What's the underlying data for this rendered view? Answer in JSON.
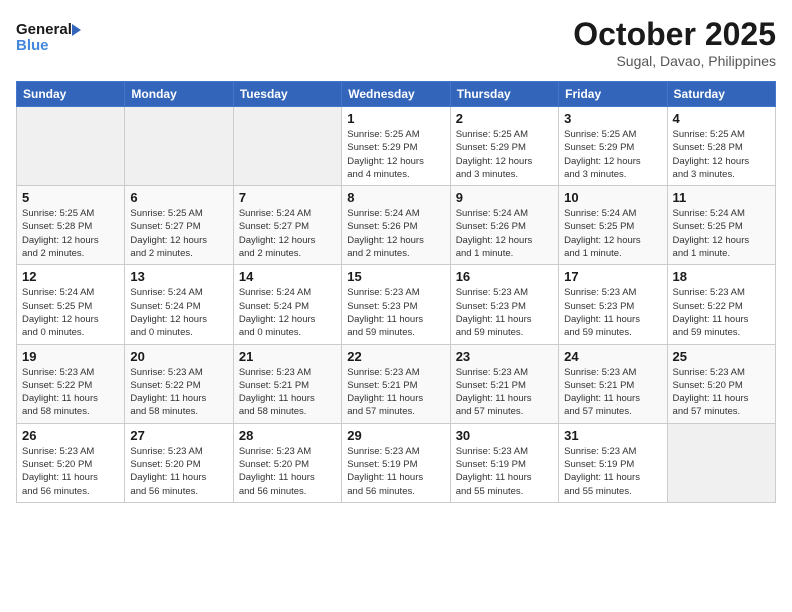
{
  "logo": {
    "line1": "General",
    "line2": "Blue"
  },
  "title": "October 2025",
  "location": "Sugal, Davao, Philippines",
  "weekdays": [
    "Sunday",
    "Monday",
    "Tuesday",
    "Wednesday",
    "Thursday",
    "Friday",
    "Saturday"
  ],
  "weeks": [
    [
      {
        "day": "",
        "info": ""
      },
      {
        "day": "",
        "info": ""
      },
      {
        "day": "",
        "info": ""
      },
      {
        "day": "1",
        "info": "Sunrise: 5:25 AM\nSunset: 5:29 PM\nDaylight: 12 hours\nand 4 minutes."
      },
      {
        "day": "2",
        "info": "Sunrise: 5:25 AM\nSunset: 5:29 PM\nDaylight: 12 hours\nand 3 minutes."
      },
      {
        "day": "3",
        "info": "Sunrise: 5:25 AM\nSunset: 5:29 PM\nDaylight: 12 hours\nand 3 minutes."
      },
      {
        "day": "4",
        "info": "Sunrise: 5:25 AM\nSunset: 5:28 PM\nDaylight: 12 hours\nand 3 minutes."
      }
    ],
    [
      {
        "day": "5",
        "info": "Sunrise: 5:25 AM\nSunset: 5:28 PM\nDaylight: 12 hours\nand 2 minutes."
      },
      {
        "day": "6",
        "info": "Sunrise: 5:25 AM\nSunset: 5:27 PM\nDaylight: 12 hours\nand 2 minutes."
      },
      {
        "day": "7",
        "info": "Sunrise: 5:24 AM\nSunset: 5:27 PM\nDaylight: 12 hours\nand 2 minutes."
      },
      {
        "day": "8",
        "info": "Sunrise: 5:24 AM\nSunset: 5:26 PM\nDaylight: 12 hours\nand 2 minutes."
      },
      {
        "day": "9",
        "info": "Sunrise: 5:24 AM\nSunset: 5:26 PM\nDaylight: 12 hours\nand 1 minute."
      },
      {
        "day": "10",
        "info": "Sunrise: 5:24 AM\nSunset: 5:25 PM\nDaylight: 12 hours\nand 1 minute."
      },
      {
        "day": "11",
        "info": "Sunrise: 5:24 AM\nSunset: 5:25 PM\nDaylight: 12 hours\nand 1 minute."
      }
    ],
    [
      {
        "day": "12",
        "info": "Sunrise: 5:24 AM\nSunset: 5:25 PM\nDaylight: 12 hours\nand 0 minutes."
      },
      {
        "day": "13",
        "info": "Sunrise: 5:24 AM\nSunset: 5:24 PM\nDaylight: 12 hours\nand 0 minutes."
      },
      {
        "day": "14",
        "info": "Sunrise: 5:24 AM\nSunset: 5:24 PM\nDaylight: 12 hours\nand 0 minutes."
      },
      {
        "day": "15",
        "info": "Sunrise: 5:23 AM\nSunset: 5:23 PM\nDaylight: 11 hours\nand 59 minutes."
      },
      {
        "day": "16",
        "info": "Sunrise: 5:23 AM\nSunset: 5:23 PM\nDaylight: 11 hours\nand 59 minutes."
      },
      {
        "day": "17",
        "info": "Sunrise: 5:23 AM\nSunset: 5:23 PM\nDaylight: 11 hours\nand 59 minutes."
      },
      {
        "day": "18",
        "info": "Sunrise: 5:23 AM\nSunset: 5:22 PM\nDaylight: 11 hours\nand 59 minutes."
      }
    ],
    [
      {
        "day": "19",
        "info": "Sunrise: 5:23 AM\nSunset: 5:22 PM\nDaylight: 11 hours\nand 58 minutes."
      },
      {
        "day": "20",
        "info": "Sunrise: 5:23 AM\nSunset: 5:22 PM\nDaylight: 11 hours\nand 58 minutes."
      },
      {
        "day": "21",
        "info": "Sunrise: 5:23 AM\nSunset: 5:21 PM\nDaylight: 11 hours\nand 58 minutes."
      },
      {
        "day": "22",
        "info": "Sunrise: 5:23 AM\nSunset: 5:21 PM\nDaylight: 11 hours\nand 57 minutes."
      },
      {
        "day": "23",
        "info": "Sunrise: 5:23 AM\nSunset: 5:21 PM\nDaylight: 11 hours\nand 57 minutes."
      },
      {
        "day": "24",
        "info": "Sunrise: 5:23 AM\nSunset: 5:21 PM\nDaylight: 11 hours\nand 57 minutes."
      },
      {
        "day": "25",
        "info": "Sunrise: 5:23 AM\nSunset: 5:20 PM\nDaylight: 11 hours\nand 57 minutes."
      }
    ],
    [
      {
        "day": "26",
        "info": "Sunrise: 5:23 AM\nSunset: 5:20 PM\nDaylight: 11 hours\nand 56 minutes."
      },
      {
        "day": "27",
        "info": "Sunrise: 5:23 AM\nSunset: 5:20 PM\nDaylight: 11 hours\nand 56 minutes."
      },
      {
        "day": "28",
        "info": "Sunrise: 5:23 AM\nSunset: 5:20 PM\nDaylight: 11 hours\nand 56 minutes."
      },
      {
        "day": "29",
        "info": "Sunrise: 5:23 AM\nSunset: 5:19 PM\nDaylight: 11 hours\nand 56 minutes."
      },
      {
        "day": "30",
        "info": "Sunrise: 5:23 AM\nSunset: 5:19 PM\nDaylight: 11 hours\nand 55 minutes."
      },
      {
        "day": "31",
        "info": "Sunrise: 5:23 AM\nSunset: 5:19 PM\nDaylight: 11 hours\nand 55 minutes."
      },
      {
        "day": "",
        "info": ""
      }
    ]
  ]
}
